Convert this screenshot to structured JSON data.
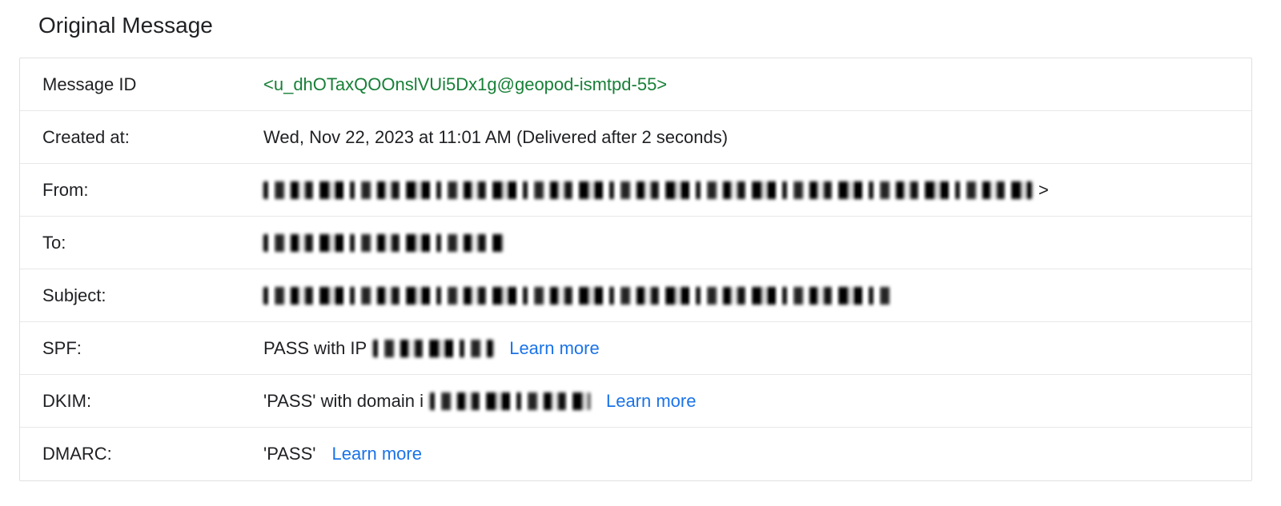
{
  "section_title": "Original Message",
  "labels": {
    "message_id": "Message ID",
    "created_at": "Created at:",
    "from": "From:",
    "to": "To:",
    "subject": "Subject:",
    "spf": "SPF:",
    "dkim": "DKIM:",
    "dmarc": "DMARC:"
  },
  "values": {
    "message_id": "<u_dhOTaxQOOnslVUi5Dx1g@geopod-ismtpd-55>",
    "created_at": "Wed, Nov 22, 2023 at 11:01 AM (Delivered after 2 seconds)",
    "from_suffix": ">",
    "spf_prefix": "PASS with IP ",
    "dkim_prefix": "'PASS' with domain i",
    "dmarc": "'PASS'"
  },
  "links": {
    "learn_more": "Learn more"
  }
}
